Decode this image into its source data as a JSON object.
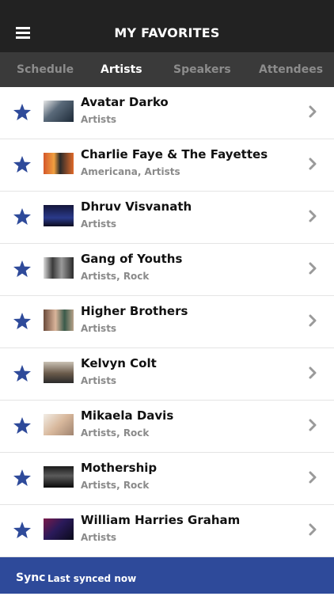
{
  "header": {
    "title": "MY FAVORITES",
    "menu_icon": "hamburger-menu-icon"
  },
  "tabs": [
    {
      "label": "Schedule",
      "active": false
    },
    {
      "label": "Artists",
      "active": true
    },
    {
      "label": "Speakers",
      "active": false
    },
    {
      "label": "Attendees",
      "active": false
    }
  ],
  "items": [
    {
      "name": "Avatar Darko",
      "tags": "Artists",
      "starred": true
    },
    {
      "name": "Charlie Faye & The Fayettes",
      "tags": "Americana, Artists",
      "starred": true
    },
    {
      "name": "Dhruv Visvanath",
      "tags": "Artists",
      "starred": true
    },
    {
      "name": "Gang of Youths",
      "tags": "Artists, Rock",
      "starred": true
    },
    {
      "name": "Higher Brothers",
      "tags": "Artists",
      "starred": true
    },
    {
      "name": "Kelvyn Colt",
      "tags": "Artists",
      "starred": true
    },
    {
      "name": "Mikaela Davis",
      "tags": "Artists, Rock",
      "starred": true
    },
    {
      "name": "Mothership",
      "tags": "Artists, Rock",
      "starred": true
    },
    {
      "name": "William Harries Graham",
      "tags": "Artists",
      "starred": true
    }
  ],
  "footer": {
    "sync_label": "Sync",
    "status": "Last synced now"
  },
  "colors": {
    "header": "#222222",
    "tabs": "#3a3a3a",
    "star": "#2e4a9a",
    "footer": "#2e4a9a"
  }
}
